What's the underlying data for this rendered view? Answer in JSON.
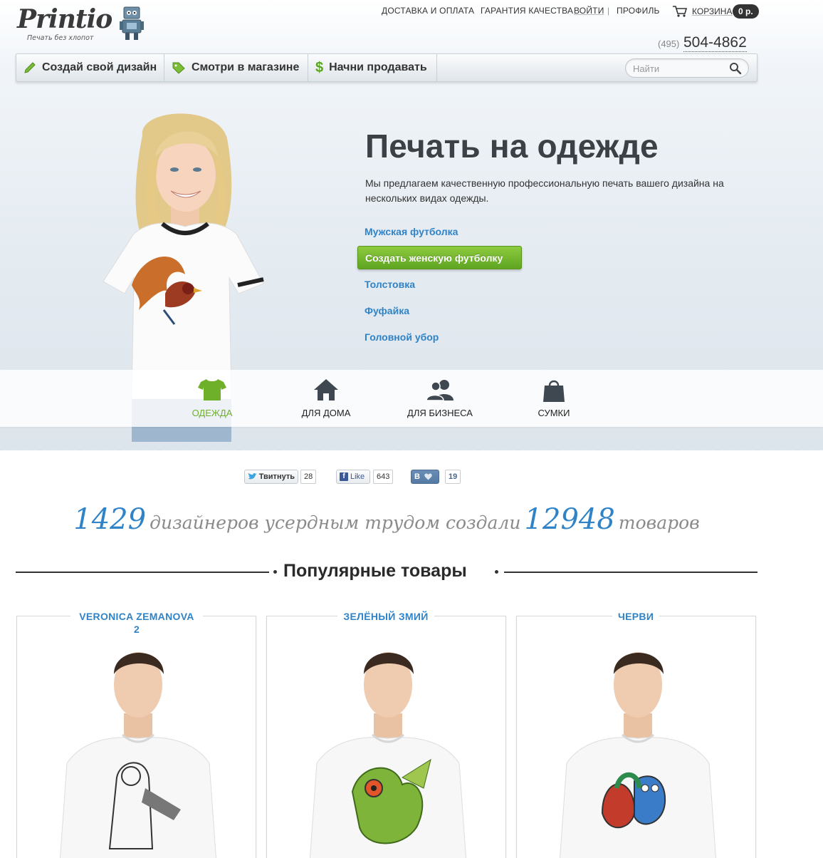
{
  "header": {
    "logo_word": "Printio",
    "logo_tagline": "Печать без хлопот",
    "nav": {
      "delivery": "ДОСТАВКА И ОПЛАТА",
      "quality": "ГАРАНТИЯ КАЧЕСТВА",
      "login": "ВОЙТИ",
      "separator": "|",
      "profile": "ПРОФИЛЬ",
      "cart": "КОРЗИНА",
      "cart_total": "0 р."
    },
    "phone_code": "(495)",
    "phone_number": "504-4862"
  },
  "actions": {
    "create_design": "Создай свой дизайн",
    "shop": "Смотри в магазине",
    "sell": "Начни продавать",
    "search_placeholder": "Найти"
  },
  "hero": {
    "title": "Печать на одежде",
    "description": "Мы предлагаем качественную профессиональную печать вашего дизайна на нескольких видах одежды.",
    "links": [
      "Мужская футболка",
      "Толстовка",
      "Фуфайка",
      "Головной убор"
    ],
    "cta": "Создать женскую футболку"
  },
  "categories": [
    {
      "label": "ОДЕЖДА",
      "icon": "tshirt-icon",
      "active": true
    },
    {
      "label": "ДЛЯ ДОМА",
      "icon": "home-icon",
      "active": false
    },
    {
      "label": "ДЛЯ БИЗНЕСА",
      "icon": "people-icon",
      "active": false
    },
    {
      "label": "СУМКИ",
      "icon": "bag-icon",
      "active": false
    }
  ],
  "social": {
    "tweet_label": "Твитнуть",
    "tweet_count": "28",
    "fb_label": "Like",
    "fb_count": "643",
    "vk_label": "В",
    "vk_count": "19"
  },
  "stats": {
    "designers": "1429",
    "text1": "дизайнеров усердным трудом создали",
    "products": "12948",
    "text2": "товаров"
  },
  "popular": {
    "title": "Популярные товары",
    "items": [
      {
        "title": "VERONICA ZEMANOVA 2"
      },
      {
        "title": "ЗЕЛЁНЫЙ ЗМИЙ"
      },
      {
        "title": "ЧЕРВИ"
      }
    ]
  },
  "colors": {
    "accent_blue": "#2f83c6",
    "accent_green": "#6fb02b",
    "dark_text": "#333333"
  }
}
